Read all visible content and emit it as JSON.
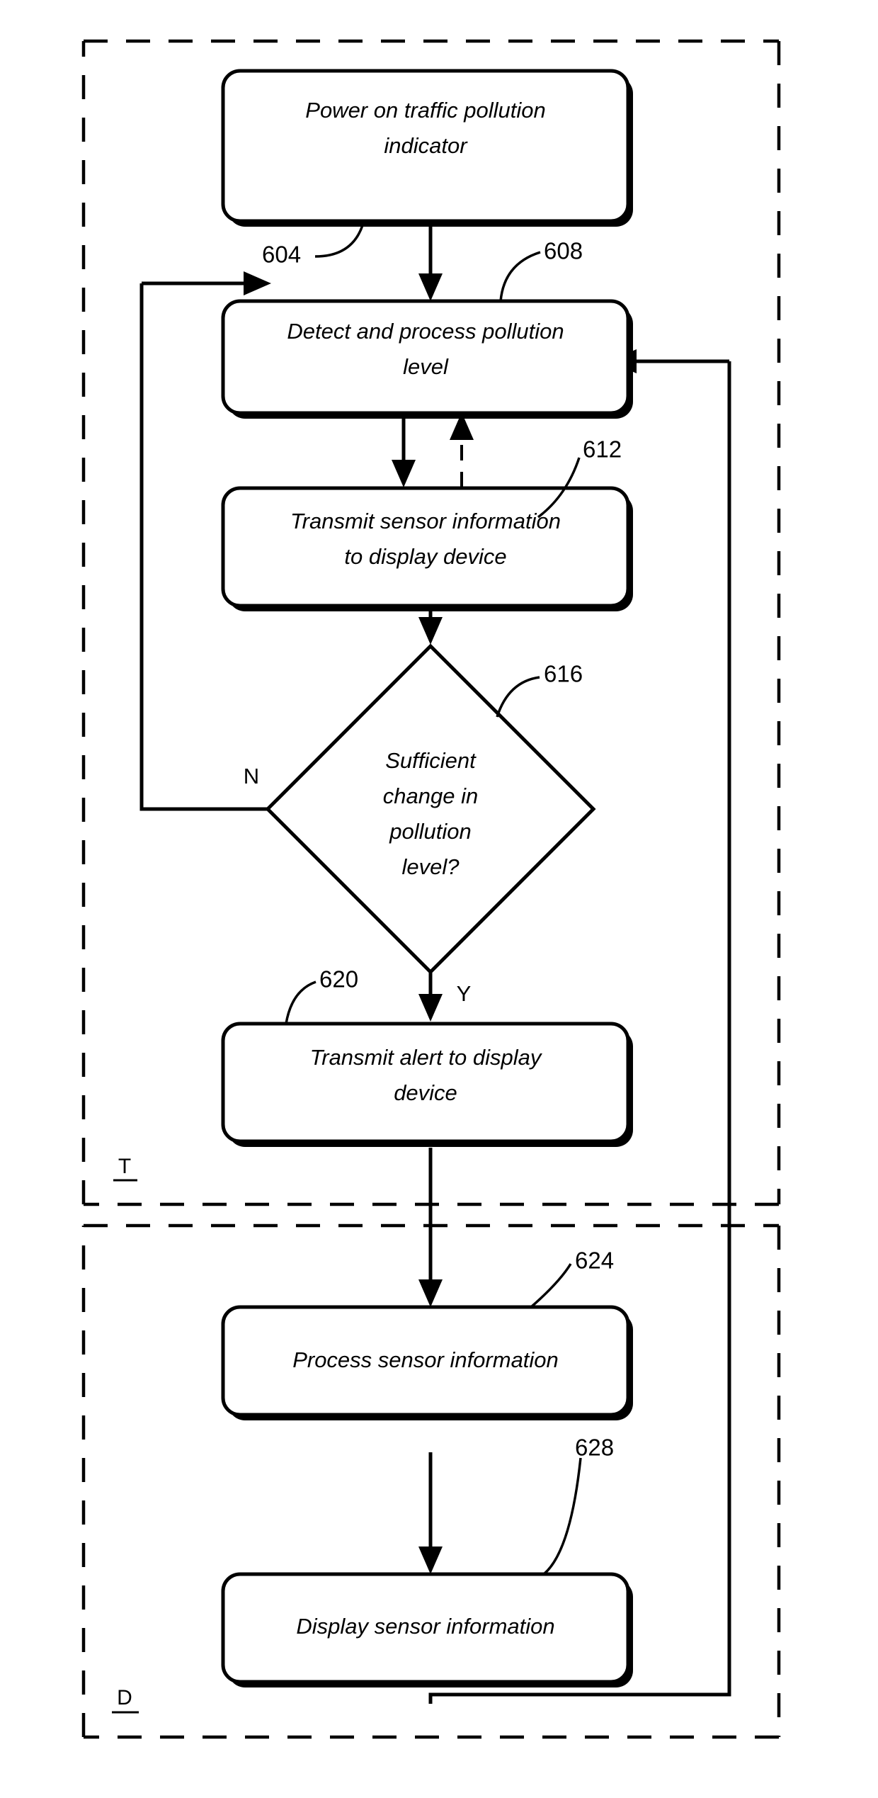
{
  "figure": {
    "type": "patent-flowchart",
    "background_color": "#ffffff",
    "line_color": "#000000"
  },
  "sections": {
    "transmitter": {
      "label": "T",
      "name": "transmitter-section"
    },
    "display": {
      "label": "D",
      "name": "display-section"
    }
  },
  "nodes": [
    {
      "id": "power-on",
      "shape": "process",
      "lines": [
        "Power on traffic pollution",
        "indicator"
      ],
      "ref": "604"
    },
    {
      "id": "detect-process",
      "shape": "process",
      "lines": [
        "Detect and process pollution",
        "level"
      ],
      "ref": "608"
    },
    {
      "id": "transmit-sensor-info",
      "shape": "process",
      "lines": [
        "Transmit sensor information",
        "to display device"
      ],
      "ref": "612"
    },
    {
      "id": "sufficient-change",
      "shape": "decision",
      "lines": [
        "Sufficient",
        "change in",
        "pollution",
        "level?"
      ],
      "ref": "616"
    },
    {
      "id": "transmit-alert",
      "shape": "process",
      "lines": [
        "Transmit alert to display",
        "device"
      ],
      "ref": "620"
    },
    {
      "id": "process-sensor-info",
      "shape": "process",
      "lines": [
        "Process sensor information"
      ],
      "ref": "624"
    },
    {
      "id": "display-sensor-info",
      "shape": "process",
      "lines": [
        "Display sensor information"
      ],
      "ref": "628"
    }
  ],
  "branches": {
    "no_label": "N",
    "yes_label": "Y"
  },
  "text": {
    "power_on_l1": "Power on traffic pollution",
    "power_on_l2": "indicator",
    "detect_l1": "Detect and process pollution",
    "detect_l2": "level",
    "transmit_sensor_l1": "Transmit sensor information",
    "transmit_sensor_l2": "to display device",
    "decision_l1": "Sufficient",
    "decision_l2": "change in",
    "decision_l3": "pollution",
    "decision_l4": "level?",
    "transmit_alert_l1": "Transmit alert to display",
    "transmit_alert_l2": "device",
    "process_sensor": "Process sensor information",
    "display_sensor": "Display sensor information",
    "ref_604": "604",
    "ref_608": "608",
    "ref_612": "612",
    "ref_616": "616",
    "ref_620": "620",
    "ref_624": "624",
    "ref_628": "628",
    "label_N": "N",
    "label_Y": "Y",
    "label_T": "T",
    "label_D": "D"
  }
}
